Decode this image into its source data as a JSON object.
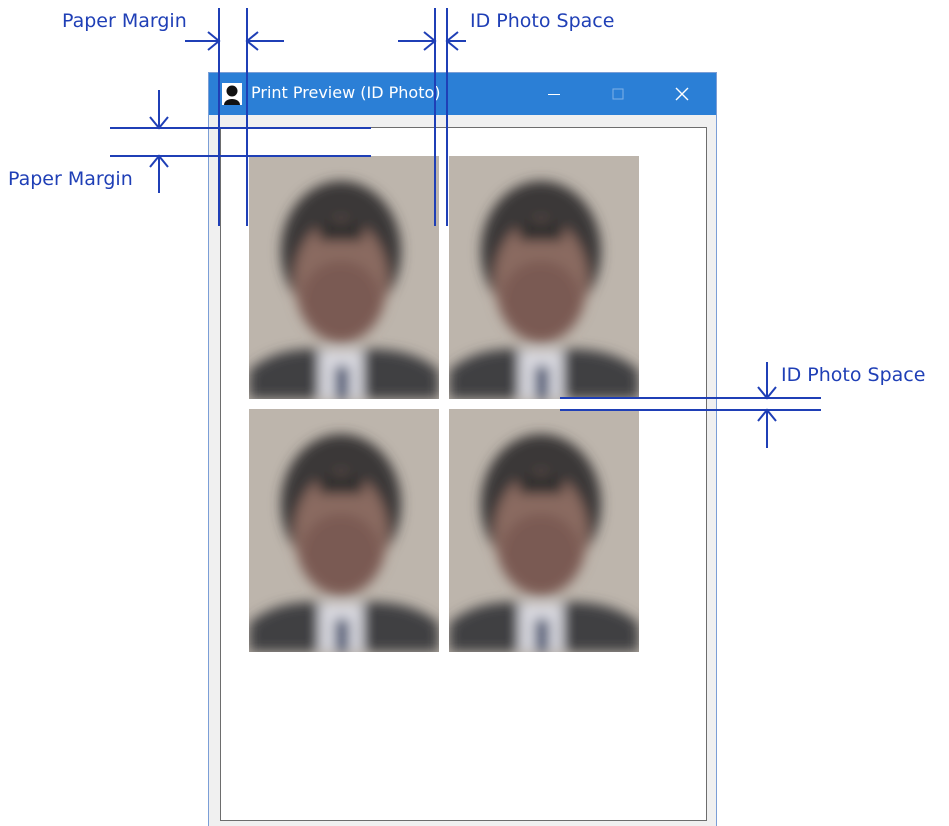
{
  "window": {
    "title": "Print Preview (ID Photo)",
    "controls": {
      "minimize": "minimize",
      "maximize": "maximize",
      "close": "close"
    }
  },
  "photos": [
    {
      "subject": "id-photo"
    },
    {
      "subject": "id-photo"
    },
    {
      "subject": "id-photo"
    },
    {
      "subject": "id-photo"
    }
  ],
  "annotations": {
    "paper_margin_horizontal": "Paper Margin",
    "id_photo_space_horizontal": "ID Photo Space",
    "paper_margin_vertical": "Paper Margin",
    "id_photo_space_vertical": "ID Photo Space"
  },
  "colors": {
    "titlebar": "#2b7fd6",
    "annotation": "#1f3fb6",
    "window_bg": "#f0f0f0"
  }
}
